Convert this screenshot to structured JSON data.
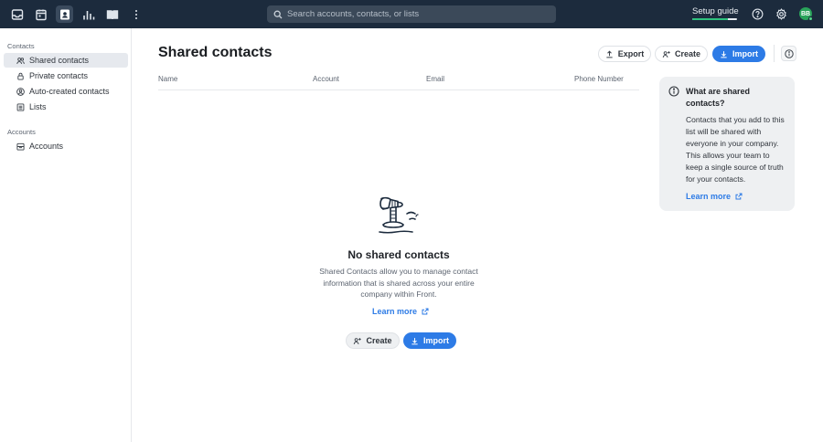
{
  "topbar": {
    "nav_icons": [
      "inbox-icon",
      "calendar-icon",
      "contacts-icon",
      "analytics-icon",
      "knowledge-base-icon",
      "more-icon"
    ],
    "search_placeholder": "Search accounts, contacts, or lists",
    "setup_guide_label": "Setup guide",
    "setup_progress": 0.8,
    "avatar_initials": "BB"
  },
  "sidebar": {
    "contacts_heading": "Contacts",
    "contact_items": [
      {
        "label": "Shared contacts",
        "icon": "users-icon",
        "active": true
      },
      {
        "label": "Private contacts",
        "icon": "lock-icon",
        "active": false
      },
      {
        "label": "Auto-created contacts",
        "icon": "auto-user-icon",
        "active": false
      },
      {
        "label": "Lists",
        "icon": "list-icon",
        "active": false
      }
    ],
    "accounts_heading": "Accounts",
    "account_items": [
      {
        "label": "Accounts",
        "icon": "building-icon",
        "active": false
      }
    ]
  },
  "main": {
    "title": "Shared contacts",
    "export_label": "Export",
    "create_label": "Create",
    "import_label": "Import",
    "columns": [
      "Name",
      "Account",
      "Email",
      "Phone Number"
    ],
    "empty_state": {
      "title": "No shared contacts",
      "description": "Shared Contacts allow you to manage contact information that is shared across your entire company within Front.",
      "learn_more": "Learn more",
      "create_label": "Create",
      "import_label": "Import"
    }
  },
  "info_panel": {
    "title": "What are shared contacts?",
    "body": "Contacts that you add to this list will be shared with everyone in your company. This allows your team to keep a single source of truth for your contacts.",
    "learn_more": "Learn more"
  },
  "colors": {
    "topbar_bg": "#1c2b3d",
    "primary": "#2d7be6",
    "progress": "#2ec27e",
    "avatar": "#29a35a"
  }
}
